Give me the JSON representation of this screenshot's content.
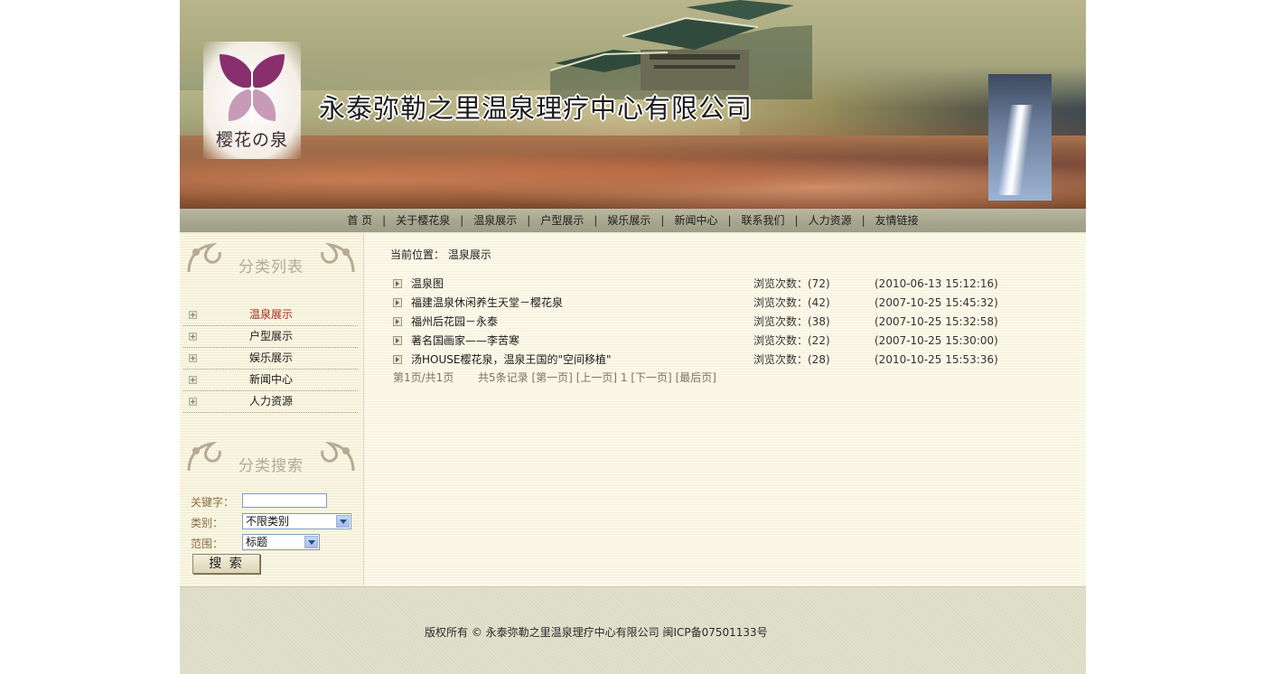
{
  "banner": {
    "company_name": "永泰弥勒之里温泉理疗中心有限公司",
    "logo_text": "樱花の泉"
  },
  "nav": {
    "items": [
      "首 页",
      "关于樱花泉",
      "温泉展示",
      "户型展示",
      "娱乐展示",
      "新闻中心",
      "联系我们",
      "人力资源",
      "友情链接"
    ],
    "separator": "|"
  },
  "sidebar": {
    "category_heading": "分类列表",
    "categories": [
      {
        "label": "温泉展示",
        "active": true
      },
      {
        "label": "户型展示",
        "active": false
      },
      {
        "label": "娱乐展示",
        "active": false
      },
      {
        "label": "新闻中心",
        "active": false
      },
      {
        "label": "人力资源",
        "active": false
      }
    ],
    "search_heading": "分类搜索",
    "search": {
      "keyword_label": "关键字：",
      "keyword_value": "",
      "category_label": "类别：",
      "category_value": "不限类别",
      "scope_label": "范围：",
      "scope_value": "标题",
      "button_label": "搜 索"
    }
  },
  "main": {
    "breadcrumb": "当前位置： 温泉展示",
    "articles": [
      {
        "title": "温泉图",
        "views": "浏览次数：(72)",
        "date": "(2010-06-13 15:12:16)"
      },
      {
        "title": "福建温泉休闲养生天堂－樱花泉",
        "views": "浏览次数：(42)",
        "date": "(2007-10-25 15:45:32)"
      },
      {
        "title": "福州后花园－永泰",
        "views": "浏览次数：(38)",
        "date": "(2007-10-25 15:32:58)"
      },
      {
        "title": "著名国画家——李苦寒",
        "views": "浏览次数：(22)",
        "date": "(2007-10-25 15:30:00)"
      },
      {
        "title": "汤HOUSE樱花泉，温泉王国的\"空间移植\"",
        "views": "浏览次数：(28)",
        "date": "(2010-10-25 15:53:36)"
      }
    ],
    "pager": {
      "page_info": "第1页/共1页",
      "total": "共5条记录",
      "first": "[第一页]",
      "prev": "[上一页]",
      "current": "1",
      "next": "[下一页]",
      "last": "[最后页]"
    }
  },
  "footer": {
    "copyright": "版权所有 © 永泰弥勒之里温泉理疗中心有限公司 闽ICP备07501133号"
  }
}
